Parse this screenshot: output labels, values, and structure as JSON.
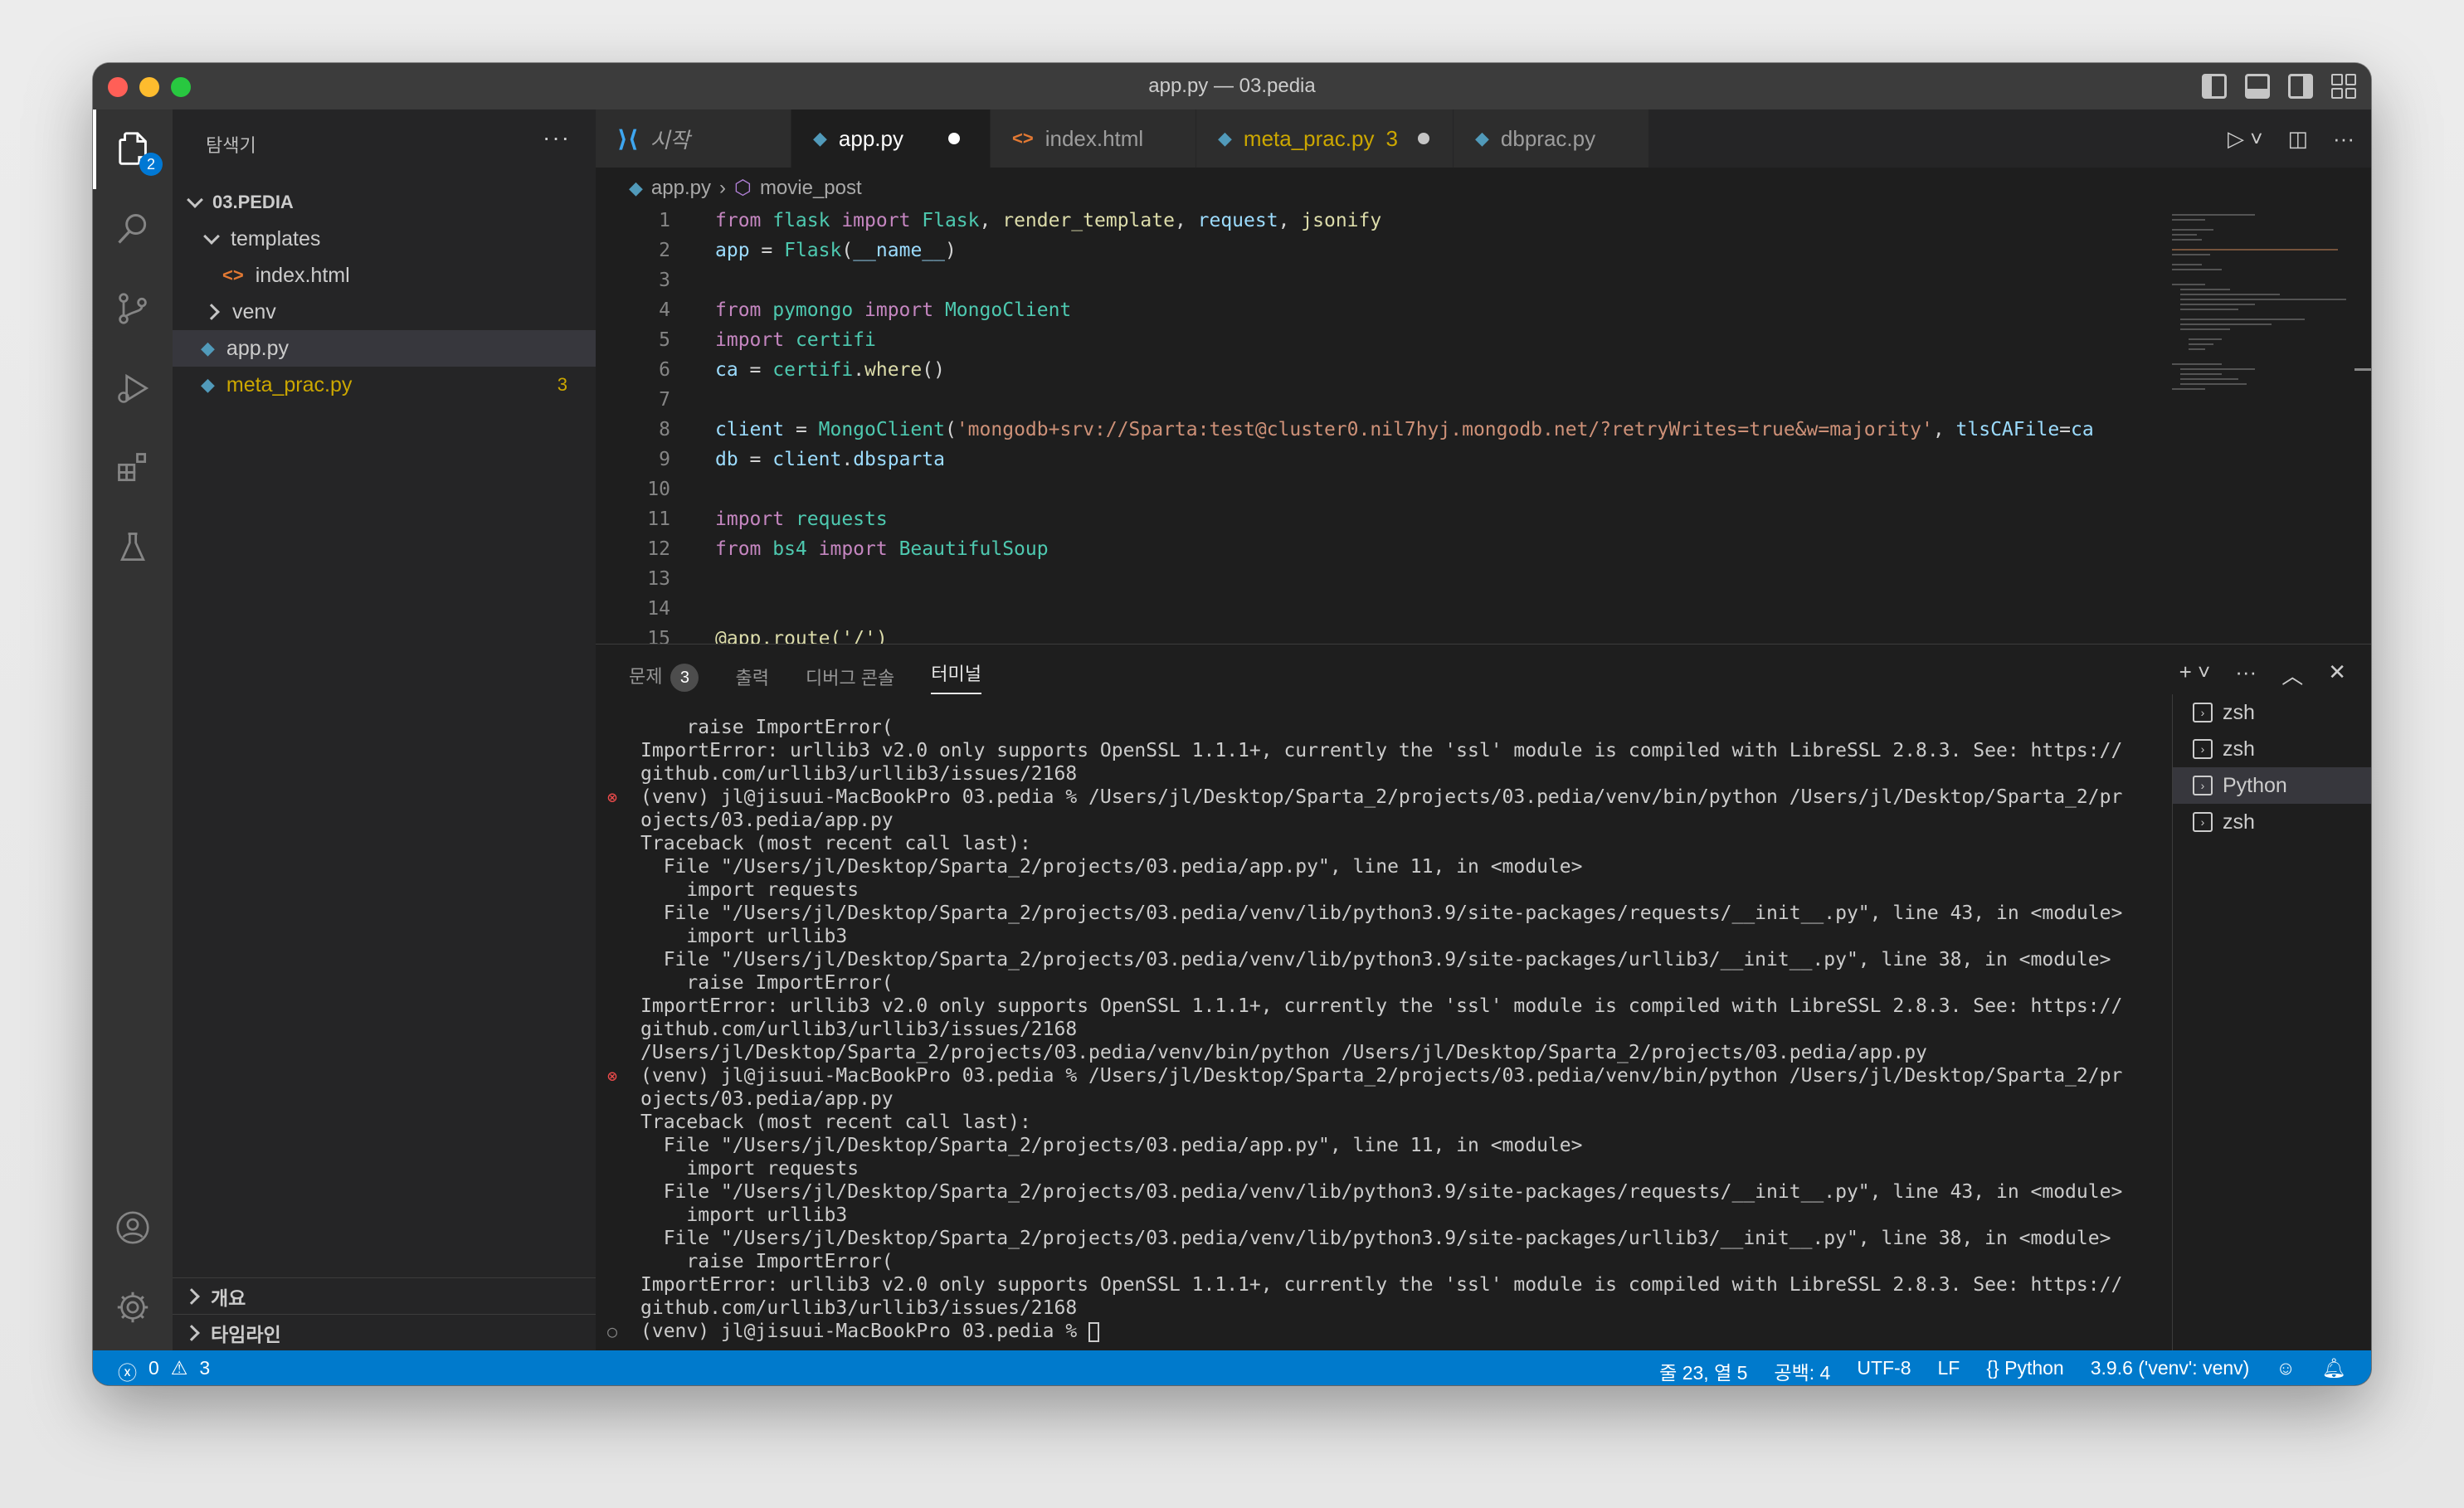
{
  "window": {
    "title": "app.py — 03.pedia"
  },
  "activity": {
    "explorer_badge": "2"
  },
  "sidebar": {
    "header": "탐색기",
    "more": "···",
    "root": "03.PEDIA",
    "items": [
      {
        "label": "templates",
        "type": "folder",
        "expanded": true
      },
      {
        "label": "index.html",
        "type": "html-file"
      },
      {
        "label": "venv",
        "type": "folder",
        "expanded": false
      },
      {
        "label": "app.py",
        "type": "py-file",
        "selected": true
      },
      {
        "label": "meta_prac.py",
        "type": "py-file",
        "problems": "3",
        "color": "#cca700"
      }
    ],
    "outline": "개요",
    "timeline": "타임라인"
  },
  "tabs": [
    {
      "label": "시작",
      "icon": "vscode-icon"
    },
    {
      "label": "app.py",
      "icon": "python-icon",
      "active": true,
      "modified": true
    },
    {
      "label": "index.html",
      "icon": "html-icon"
    },
    {
      "label": "meta_prac.py",
      "icon": "python-icon",
      "problems": "3",
      "modified": true
    },
    {
      "label": "dbprac.py",
      "icon": "python-icon"
    }
  ],
  "breadcrumb": {
    "file": "app.py",
    "symbol": "movie_post"
  },
  "code": {
    "line_numbers": [
      "1",
      "2",
      "3",
      "4",
      "5",
      "6",
      "7",
      "8",
      "9",
      "10",
      "11",
      "12",
      "13",
      "14",
      "15"
    ],
    "l1": {
      "a": "from",
      "b": " flask ",
      "c": "import",
      "d": " Flask",
      "e": ", ",
      "f": "render_template",
      "g": ", ",
      "h": "request",
      "i": ", ",
      "j": "jsonify"
    },
    "l2": {
      "a": "app",
      "b": " = ",
      "c": "Flask",
      "d": "(",
      "e": "__name__",
      "f": ")"
    },
    "l4": {
      "a": "from",
      "b": " pymongo ",
      "c": "import",
      "d": " MongoClient"
    },
    "l5": {
      "a": "import",
      "b": " certifi"
    },
    "l6": {
      "a": "ca",
      "b": " = ",
      "c": "certifi",
      "d": ".",
      "e": "where",
      "f": "()"
    },
    "l8": {
      "a": "client",
      "b": " = ",
      "c": "MongoClient",
      "d": "(",
      "e": "'mongodb+srv://Sparta:test@cluster0.nil7hyj.mongodb.net/?retryWrites=true&w=majority'",
      "f": ", ",
      "g": "tlsCAFile",
      "h": "=",
      "i": "ca"
    },
    "l9": {
      "a": "db",
      "b": " = ",
      "c": "client",
      "d": ".",
      "e": "dbsparta"
    },
    "l11": {
      "a": "import",
      "b": " requests"
    },
    "l12": {
      "a": "from",
      "b": " bs4 ",
      "c": "import",
      "d": " BeautifulSoup"
    },
    "l15": {
      "a": "@app.route('/')"
    }
  },
  "panel": {
    "tabs": [
      "문제",
      "출력",
      "디버그 콘솔",
      "터미널"
    ],
    "problems_count": "3",
    "active_tab": "터미널"
  },
  "terminal": {
    "lines": [
      {
        "text": "    raise ImportError(",
        "marker": ""
      },
      {
        "text": "ImportError: urllib3 v2.0 only supports OpenSSL 1.1.1+, currently the 'ssl' module is compiled with LibreSSL 2.8.3. See: https://",
        "marker": ""
      },
      {
        "text": "github.com/urllib3/urllib3/issues/2168",
        "marker": ""
      },
      {
        "text": "(venv) jl@jisuui-MacBookPro 03.pedia % /Users/jl/Desktop/Sparta_2/projects/03.pedia/venv/bin/python /Users/jl/Desktop/Sparta_2/pr",
        "marker": "error"
      },
      {
        "text": "ojects/03.pedia/app.py",
        "marker": ""
      },
      {
        "text": "Traceback (most recent call last):",
        "marker": ""
      },
      {
        "text": "  File \"/Users/jl/Desktop/Sparta_2/projects/03.pedia/app.py\", line 11, in <module>",
        "marker": ""
      },
      {
        "text": "    import requests",
        "marker": ""
      },
      {
        "text": "  File \"/Users/jl/Desktop/Sparta_2/projects/03.pedia/venv/lib/python3.9/site-packages/requests/__init__.py\", line 43, in <module>",
        "marker": ""
      },
      {
        "text": "    import urllib3",
        "marker": ""
      },
      {
        "text": "  File \"/Users/jl/Desktop/Sparta_2/projects/03.pedia/venv/lib/python3.9/site-packages/urllib3/__init__.py\", line 38, in <module>",
        "marker": ""
      },
      {
        "text": "    raise ImportError(",
        "marker": ""
      },
      {
        "text": "ImportError: urllib3 v2.0 only supports OpenSSL 1.1.1+, currently the 'ssl' module is compiled with LibreSSL 2.8.3. See: https://",
        "marker": ""
      },
      {
        "text": "github.com/urllib3/urllib3/issues/2168",
        "marker": ""
      },
      {
        "text": "/Users/jl/Desktop/Sparta_2/projects/03.pedia/venv/bin/python /Users/jl/Desktop/Sparta_2/projects/03.pedia/app.py",
        "marker": ""
      },
      {
        "text": "(venv) jl@jisuui-MacBookPro 03.pedia % /Users/jl/Desktop/Sparta_2/projects/03.pedia/venv/bin/python /Users/jl/Desktop/Sparta_2/pr",
        "marker": "error"
      },
      {
        "text": "ojects/03.pedia/app.py",
        "marker": ""
      },
      {
        "text": "Traceback (most recent call last):",
        "marker": ""
      },
      {
        "text": "  File \"/Users/jl/Desktop/Sparta_2/projects/03.pedia/app.py\", line 11, in <module>",
        "marker": ""
      },
      {
        "text": "    import requests",
        "marker": ""
      },
      {
        "text": "  File \"/Users/jl/Desktop/Sparta_2/projects/03.pedia/venv/lib/python3.9/site-packages/requests/__init__.py\", line 43, in <module>",
        "marker": ""
      },
      {
        "text": "    import urllib3",
        "marker": ""
      },
      {
        "text": "  File \"/Users/jl/Desktop/Sparta_2/projects/03.pedia/venv/lib/python3.9/site-packages/urllib3/__init__.py\", line 38, in <module>",
        "marker": ""
      },
      {
        "text": "    raise ImportError(",
        "marker": ""
      },
      {
        "text": "ImportError: urllib3 v2.0 only supports OpenSSL 1.1.1+, currently the 'ssl' module is compiled with LibreSSL 2.8.3. See: https://",
        "marker": ""
      },
      {
        "text": "github.com/urllib3/urllib3/issues/2168",
        "marker": ""
      },
      {
        "text": "(venv) jl@jisuui-MacBookPro 03.pedia % ",
        "marker": "prompt"
      }
    ],
    "sessions": [
      {
        "label": "zsh"
      },
      {
        "label": "zsh"
      },
      {
        "label": "Python",
        "selected": true
      },
      {
        "label": "zsh"
      }
    ]
  },
  "status": {
    "errors": "0",
    "warnings": "3",
    "position": "줄 23, 열 5",
    "spaces": "공백: 4",
    "encoding": "UTF-8",
    "eol": "LF",
    "language": "Python",
    "interpreter": "3.9.6 ('venv': venv)"
  },
  "colors": {
    "accent": "#007acc",
    "editor_bg": "#1e1e1e",
    "sidebar_bg": "#252526",
    "activity_bg": "#333333",
    "warning": "#cca700",
    "error": "#f14c4c"
  }
}
